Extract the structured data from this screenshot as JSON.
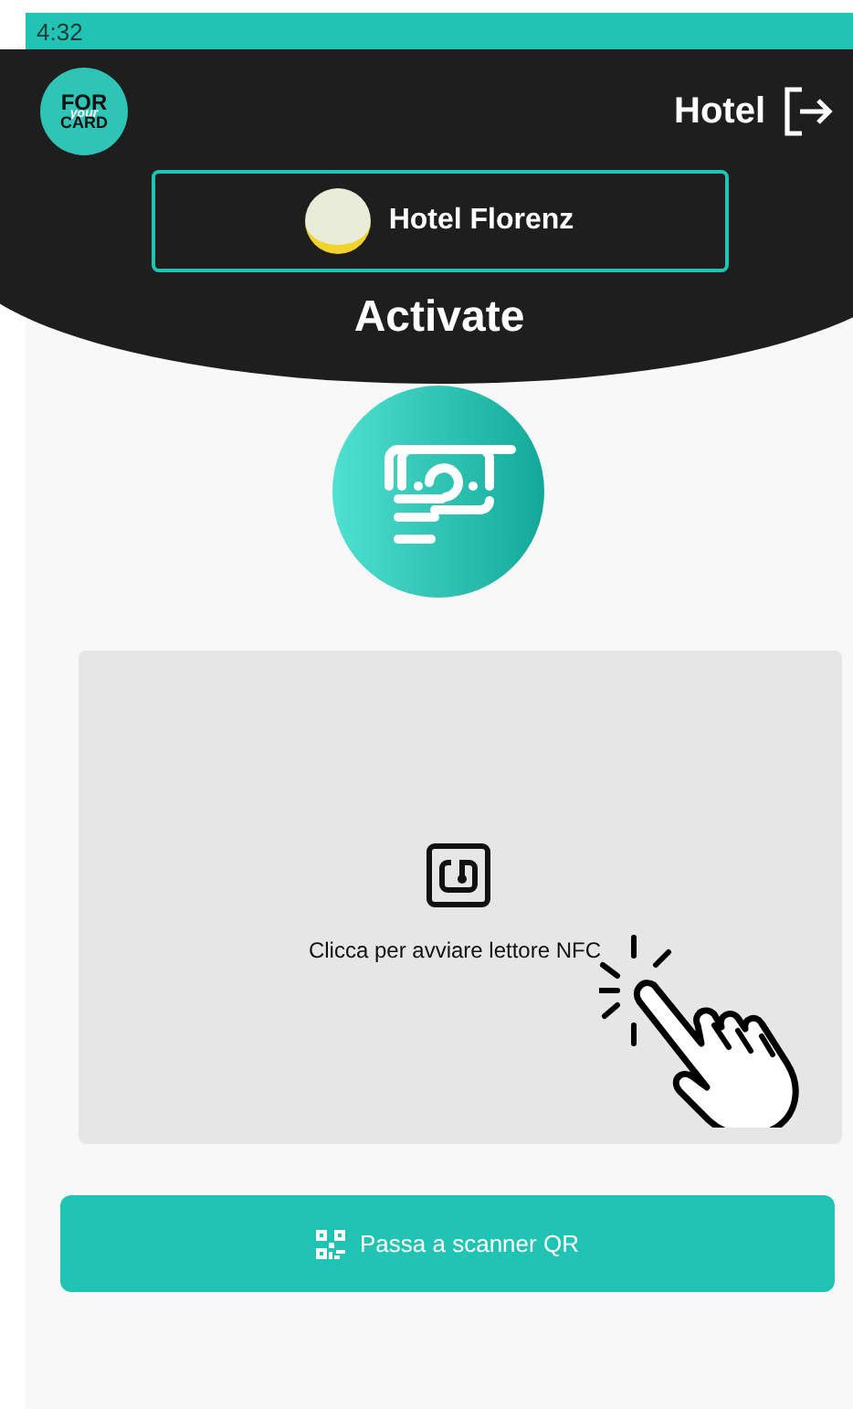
{
  "status_bar": {
    "time": "4:32"
  },
  "header": {
    "logo_text": [
      "FOR",
      "your",
      "CARD"
    ],
    "title": "Hotel"
  },
  "hotel_selector": {
    "name": "Hotel Florenz"
  },
  "page_title": "Activate",
  "nfc_panel": {
    "hint": "Clicca per avviare lettore NFC"
  },
  "qr_button": {
    "label": "Passa a scanner QR"
  }
}
